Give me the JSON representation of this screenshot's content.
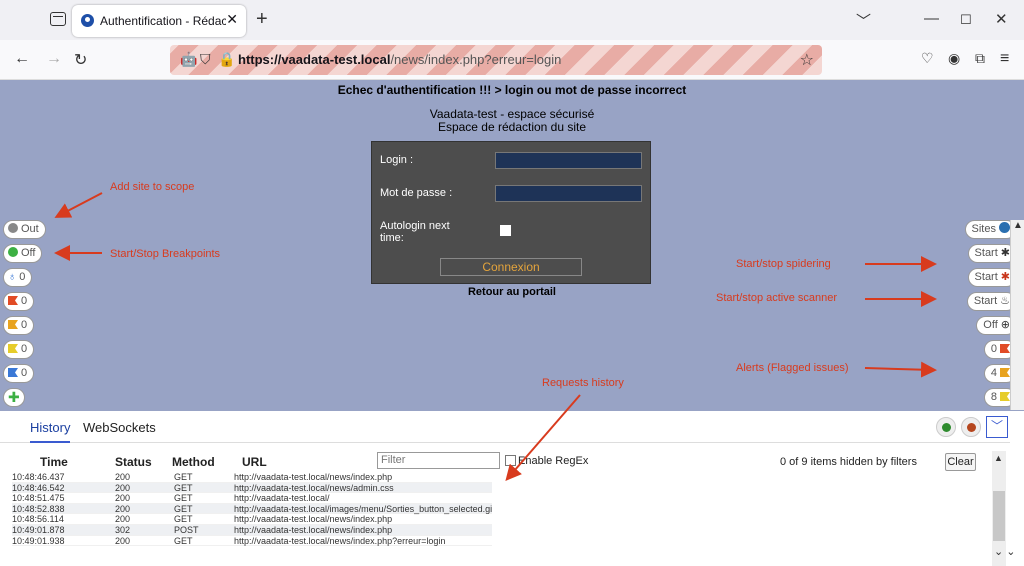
{
  "browser": {
    "tab_title": "Authentification - Rédaction de",
    "tab_close": "✕",
    "new_tab": "+",
    "url_host": "https://vaadata-test.local",
    "url_path": "/news/index.php?erreur=login"
  },
  "page": {
    "error_message": "Echec d'authentification !!! > login ou mot de passe incorrect",
    "site_name": "Vaadata-test - espace sécurisé",
    "site_subtitle": "Espace de rédaction du site",
    "login_label": "Login :",
    "password_label": "Mot de passe :",
    "autologin_label_1": "Autologin next",
    "autologin_label_2": "time:",
    "connect_button": "Connexion",
    "back_link": "Retour au portail"
  },
  "hud_left": [
    {
      "text": "Out",
      "kind": "dot",
      "color": "#888888"
    },
    {
      "text": "Off",
      "kind": "dot",
      "color": "#3cb043"
    },
    {
      "text": "0",
      "kind": "bulb",
      "color": "#3a78d6"
    },
    {
      "text": "0",
      "kind": "flag",
      "color": "r"
    },
    {
      "text": "0",
      "kind": "flag",
      "color": "o"
    },
    {
      "text": "0",
      "kind": "flag",
      "color": "y"
    },
    {
      "text": "0",
      "kind": "flag",
      "color": "b"
    },
    {
      "text": "",
      "kind": "plus",
      "color": "#3cb043"
    }
  ],
  "hud_right": [
    {
      "text": "Sites",
      "icon": "globe-icon",
      "color": "#2a6fb0"
    },
    {
      "text": "Start",
      "icon": "spider-icon",
      "color": "#333333"
    },
    {
      "text": "Start",
      "icon": "spider-red-icon",
      "color": "#c8351a"
    },
    {
      "text": "Start",
      "icon": "flame-icon",
      "color": "#333333"
    },
    {
      "text": "Off",
      "icon": "target-icon",
      "color": "#333333"
    },
    {
      "text": "0",
      "icon": "flag-icon",
      "color": "r"
    },
    {
      "text": "4",
      "icon": "flag-icon",
      "color": "o"
    },
    {
      "text": "8",
      "icon": "flag-icon",
      "color": "y"
    }
  ],
  "annotations": {
    "scope": "Add site to scope",
    "breakpoints": "Start/Stop Breakpoints",
    "spidering": "Start/stop spidering",
    "active_scanner": "Start/stop active scanner",
    "alerts": "Alerts (Flagged issues)",
    "history": "Requests history"
  },
  "panel": {
    "tabs": [
      "History",
      "WebSockets"
    ],
    "columns": [
      "Time",
      "Status",
      "Method",
      "URL"
    ],
    "filter_placeholder": "Filter",
    "regex_label": "Enable RegEx",
    "hidden_info": "0 of 9 items hidden by filters",
    "clear_button": "Clear",
    "rows": [
      [
        "10:48:46.437",
        "200",
        "GET",
        "http://vaadata-test.local/news/index.php"
      ],
      [
        "10:48:46.542",
        "200",
        "GET",
        "http://vaadata-test.local/news/admin.css"
      ],
      [
        "10:48:51.475",
        "200",
        "GET",
        "http://vaadata-test.local/"
      ],
      [
        "10:48:52.838",
        "200",
        "GET",
        "http://vaadata-test.local/images/menu/Sorties_button_selected.gif"
      ],
      [
        "10:48:56.114",
        "200",
        "GET",
        "http://vaadata-test.local/news/index.php"
      ],
      [
        "10:49:01.878",
        "302",
        "POST",
        "http://vaadata-test.local/news/index.php"
      ],
      [
        "10:49:01.938",
        "200",
        "GET",
        "http://vaadata-test.local/news/index.php?erreur=login"
      ]
    ]
  }
}
